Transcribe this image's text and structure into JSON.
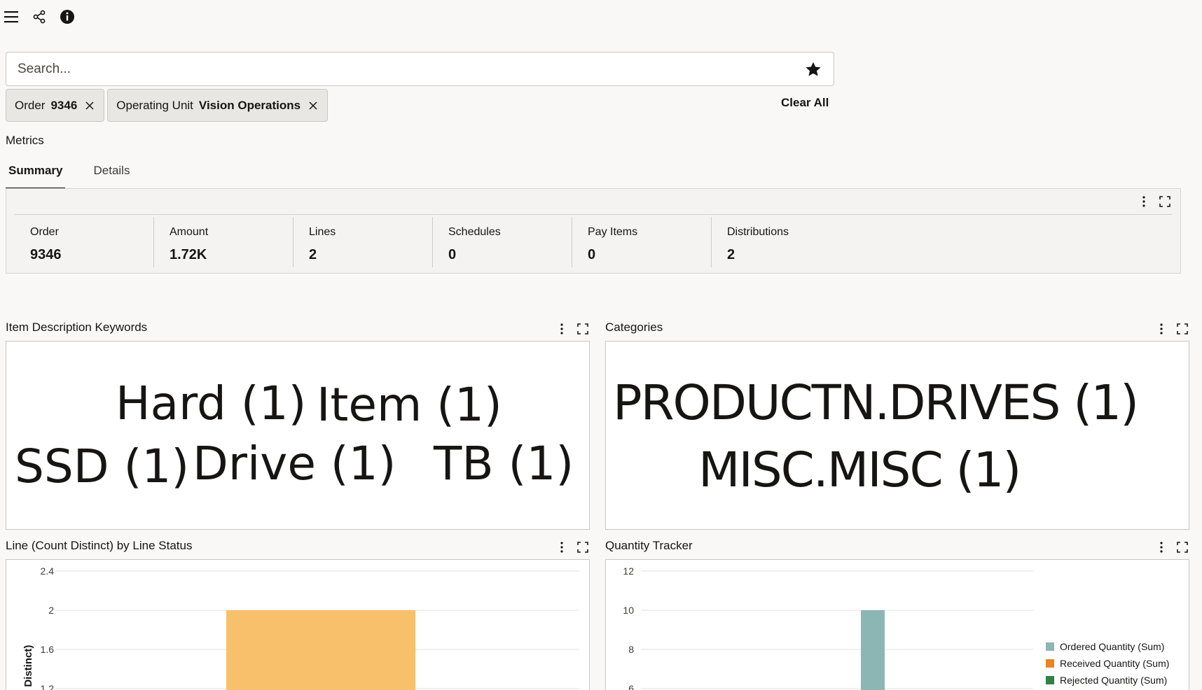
{
  "toolbar": {
    "icons": [
      "hamburger-menu-icon",
      "share-icon",
      "info-icon"
    ]
  },
  "search": {
    "placeholder": "Search..."
  },
  "filters": [
    {
      "label": "Order",
      "value": "9346"
    },
    {
      "label": "Operating Unit",
      "value": "Vision Operations"
    }
  ],
  "clear_all": "Clear All",
  "metrics": {
    "title": "Metrics",
    "tabs": [
      {
        "label": "Summary",
        "active": true
      },
      {
        "label": "Details",
        "active": false
      }
    ],
    "kpis": [
      {
        "label": "Order",
        "value": "9346"
      },
      {
        "label": "Amount",
        "value": "1.72K"
      },
      {
        "label": "Lines",
        "value": "2"
      },
      {
        "label": "Schedules",
        "value": "0"
      },
      {
        "label": "Pay Items",
        "value": "0"
      },
      {
        "label": "Distributions",
        "value": "2"
      }
    ]
  },
  "keywords": {
    "title": "Item Description Keywords",
    "words": [
      "Hard (1)",
      "Item (1)",
      "SSD (1)",
      "Drive (1)",
      "TB (1)"
    ]
  },
  "categories": {
    "title": "Categories",
    "words": [
      "PRODUCTN.DRIVES (1)",
      "MISC.MISC (1)"
    ]
  },
  "line_status": {
    "title": "Line (Count Distinct) by Line Status",
    "ylabel_visible": "nt Distinct)"
  },
  "quantity": {
    "title": "Quantity Tracker",
    "legend": [
      "Ordered Quantity (Sum)",
      "Received Quantity (Sum)",
      "Rejected Quantity (Sum)"
    ]
  },
  "colors": {
    "bar_orange": "#f8c06a",
    "ordered": "#8cb6b3",
    "received": "#e7851f",
    "rejected": "#2f8146"
  },
  "chart_data": [
    {
      "type": "bar",
      "yticks": [
        "2.4",
        "2",
        "1.6",
        "1.2"
      ],
      "ylim": [
        1.2,
        2.4
      ],
      "series": [
        {
          "values": [
            2
          ]
        }
      ],
      "ylabel": "nt Distinct)"
    },
    {
      "type": "bar",
      "yticks": [
        "12",
        "10",
        "8",
        "6"
      ],
      "ylim": [
        6,
        12
      ],
      "series": [
        {
          "name": "Ordered Quantity (Sum)",
          "values": [
            10
          ]
        },
        {
          "name": "Received Quantity (Sum)",
          "values": []
        },
        {
          "name": "Rejected Quantity (Sum)",
          "values": []
        }
      ]
    }
  ]
}
